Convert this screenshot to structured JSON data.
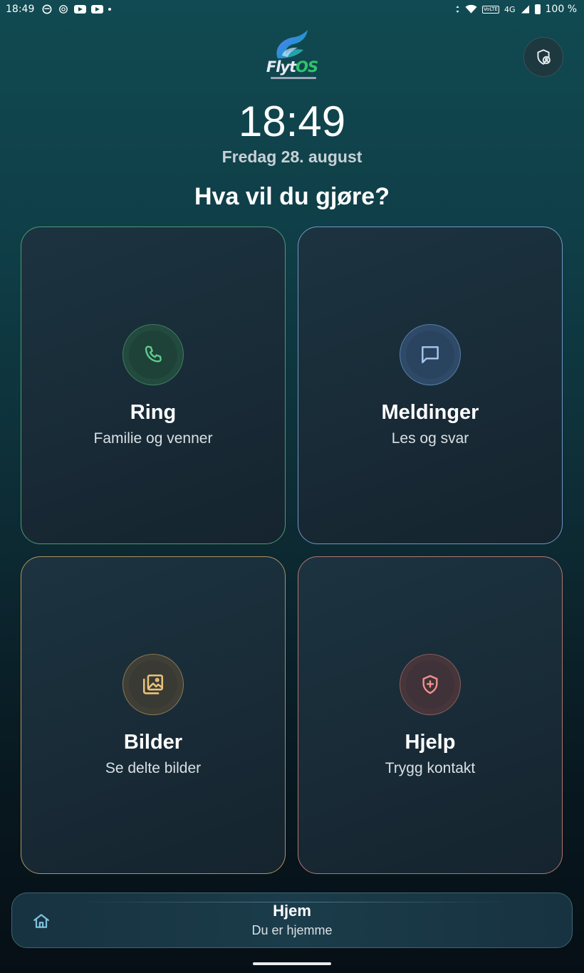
{
  "status_bar": {
    "time": "18:49",
    "network": "4G",
    "volte": "VoLTE",
    "battery": "100 %",
    "notification_icons": [
      "threads-icon",
      "chatgpt-icon",
      "youtube-icon",
      "youtube-icon"
    ]
  },
  "logo": {
    "text_main": "Flyt",
    "text_accent": "OS"
  },
  "header": {
    "clock": "18:49",
    "date": "Fredag 28. august",
    "question": "Hva vil du gjøre?"
  },
  "tiles": [
    {
      "title": "Ring",
      "subtitle": "Familie og venner",
      "icon": "phone-icon",
      "accent": "#4f9a73",
      "icon_color": "#5fcb8d"
    },
    {
      "title": "Meldinger",
      "subtitle": "Les og svar",
      "icon": "chat-bubble-icon",
      "accent": "#6f98c4",
      "icon_color": "#a8c8f0"
    },
    {
      "title": "Bilder",
      "subtitle": "Se delte bilder",
      "icon": "photo-gallery-icon",
      "accent": "#b0935e",
      "icon_color": "#e8c27a"
    },
    {
      "title": "Hjelp",
      "subtitle": "Trygg kontakt",
      "icon": "shield-plus-icon",
      "accent": "#b47571",
      "icon_color": "#f0928c"
    }
  ],
  "bottom_nav": {
    "title": "Hjem",
    "subtitle": "Du er hjemme",
    "icon": "home-icon",
    "icon_color": "#7fc3e0"
  }
}
